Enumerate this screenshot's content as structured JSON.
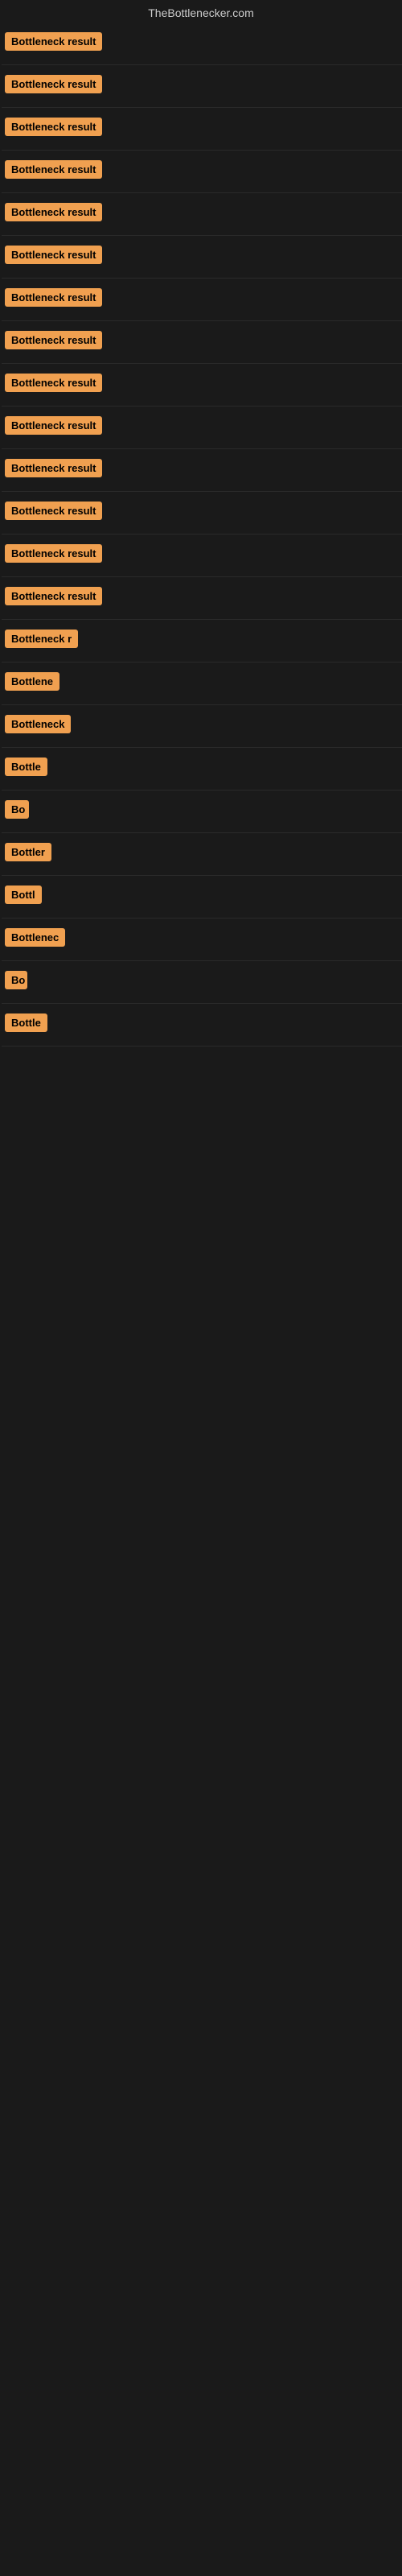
{
  "site": {
    "title": "TheBottlenecker.com"
  },
  "results": [
    {
      "id": 1,
      "label": "Bottleneck result",
      "width": 165
    },
    {
      "id": 2,
      "label": "Bottleneck result",
      "width": 165
    },
    {
      "id": 3,
      "label": "Bottleneck result",
      "width": 165
    },
    {
      "id": 4,
      "label": "Bottleneck result",
      "width": 165
    },
    {
      "id": 5,
      "label": "Bottleneck result",
      "width": 165
    },
    {
      "id": 6,
      "label": "Bottleneck result",
      "width": 165
    },
    {
      "id": 7,
      "label": "Bottleneck result",
      "width": 165
    },
    {
      "id": 8,
      "label": "Bottleneck result",
      "width": 165
    },
    {
      "id": 9,
      "label": "Bottleneck result",
      "width": 165
    },
    {
      "id": 10,
      "label": "Bottleneck result",
      "width": 165
    },
    {
      "id": 11,
      "label": "Bottleneck result",
      "width": 165
    },
    {
      "id": 12,
      "label": "Bottleneck result",
      "width": 155
    },
    {
      "id": 13,
      "label": "Bottleneck result",
      "width": 145
    },
    {
      "id": 14,
      "label": "Bottleneck result",
      "width": 138
    },
    {
      "id": 15,
      "label": "Bottleneck r",
      "width": 100
    },
    {
      "id": 16,
      "label": "Bottlene",
      "width": 80
    },
    {
      "id": 17,
      "label": "Bottleneck",
      "width": 85
    },
    {
      "id": 18,
      "label": "Bottle",
      "width": 65
    },
    {
      "id": 19,
      "label": "Bo",
      "width": 30
    },
    {
      "id": 20,
      "label": "Bottler",
      "width": 68
    },
    {
      "id": 21,
      "label": "Bottl",
      "width": 52
    },
    {
      "id": 22,
      "label": "Bottlenec",
      "width": 80
    },
    {
      "id": 23,
      "label": "Bo",
      "width": 28
    },
    {
      "id": 24,
      "label": "Bottle",
      "width": 62
    }
  ],
  "colors": {
    "badge_bg": "#f0a050",
    "badge_text": "#000000",
    "background": "#1a1a1a",
    "title_color": "#cccccc"
  }
}
